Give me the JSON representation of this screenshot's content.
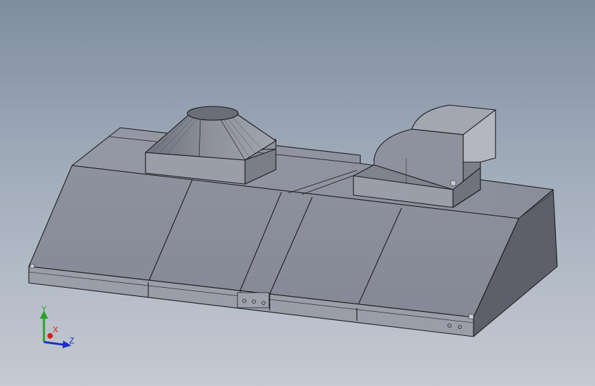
{
  "viewport": {
    "background_top": "#7f8d9f",
    "background_bottom": "#c5cad3",
    "model_face_color": "#8b8f9b",
    "model_side_color": "#5d606b",
    "model_edge_color": "#1a1a1a"
  },
  "triad": {
    "x_label": "X",
    "y_label": "Y",
    "z_label": "Z",
    "x_color": "#d4201f",
    "y_color": "#2aa12a",
    "z_color": "#1d2fc4"
  }
}
